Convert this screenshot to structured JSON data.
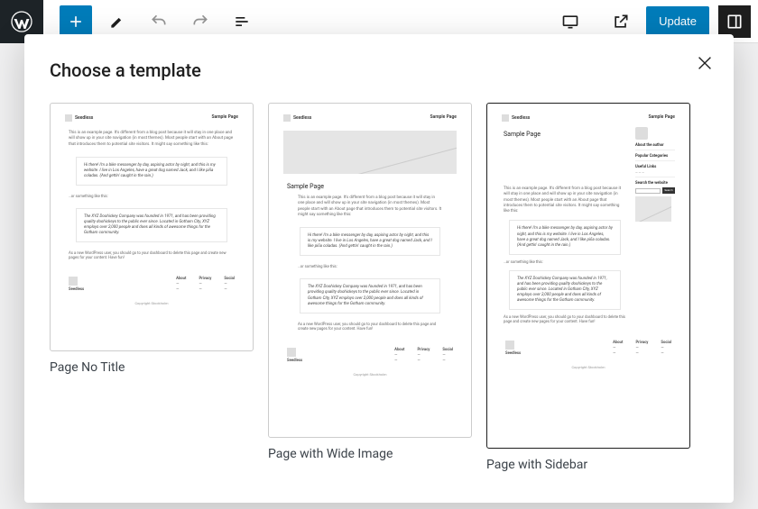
{
  "toolbar": {
    "update_label": "Update"
  },
  "modal": {
    "title": "Choose a template"
  },
  "templates": [
    {
      "label": "Page No Title"
    },
    {
      "label": "Page with Wide Image"
    },
    {
      "label": "Page with Sidebar"
    }
  ],
  "preview": {
    "brand": "Seedless",
    "page_title_label": "Sample Page",
    "intro_text": "This is an example page. It's different from a blog post because it will stay in one place and will show up in your site navigation (in most themes). Most people start with an About page that introduces them to potential site visitors. It might say something like this:",
    "block_quote_1": "Hi there! I'm a bike messenger by day, aspiring actor by night, and this is my website. I live in Los Angeles, have a great dog named Jack, and I like piña coladas. (And gettin' caught in the rain.)",
    "bridge_text": "…or something like this:",
    "block_quote_2": "The XYZ Doohickey Company was founded in 1971, and has been providing quality doohickeys to the public ever since. Located in Gotham City, XYZ employs over 2,000 people and does all kinds of awesome things for the Gotham community.",
    "outro_text": "As a new WordPress user, you should go to your dashboard to delete this page and create new pages for your content. Have fun!",
    "footer": {
      "col1": "About",
      "col2": "Privacy",
      "col3": "Social"
    },
    "copyright": "Copyright Stockholm",
    "sidebar": {
      "about_author": "About the author",
      "categories": "Popular Categories",
      "useful_links": "Useful Links",
      "search_label": "Search the website",
      "search_btn": "Search"
    }
  }
}
